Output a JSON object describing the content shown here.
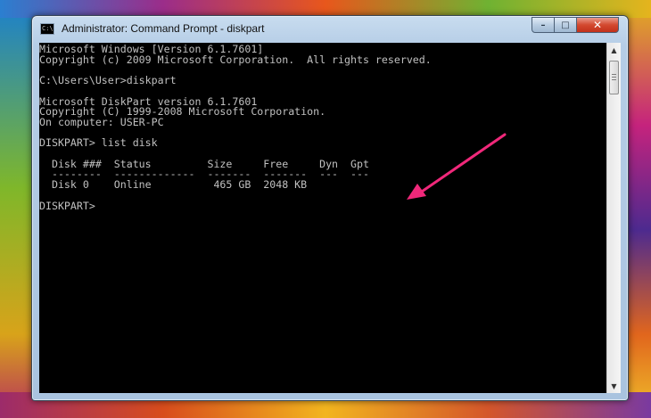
{
  "window": {
    "title": "Administrator: Command Prompt - diskpart",
    "app_icon_text": "C:\\",
    "minimize_glyph": "–",
    "maximize_glyph": "□",
    "close_glyph": "✕"
  },
  "console": {
    "lines": [
      "Microsoft Windows [Version 6.1.7601]",
      "Copyright (c) 2009 Microsoft Corporation.  All rights reserved.",
      "",
      "C:\\Users\\User>diskpart",
      "",
      "Microsoft DiskPart version 6.1.7601",
      "Copyright (C) 1999-2008 Microsoft Corporation.",
      "On computer: USER-PC",
      "",
      "DISKPART> list disk",
      "",
      "  Disk ###  Status         Size     Free     Dyn  Gpt",
      "  --------  -------------  -------  -------  ---  ---",
      "  Disk 0    Online          465 GB  2048 KB",
      "",
      "DISKPART>"
    ]
  },
  "scrollbar": {
    "up_glyph": "▲",
    "down_glyph": "▼"
  },
  "colors": {
    "console_bg": "#000000",
    "console_fg": "#c0c0c0",
    "annotation_arrow": "#f0287a"
  }
}
